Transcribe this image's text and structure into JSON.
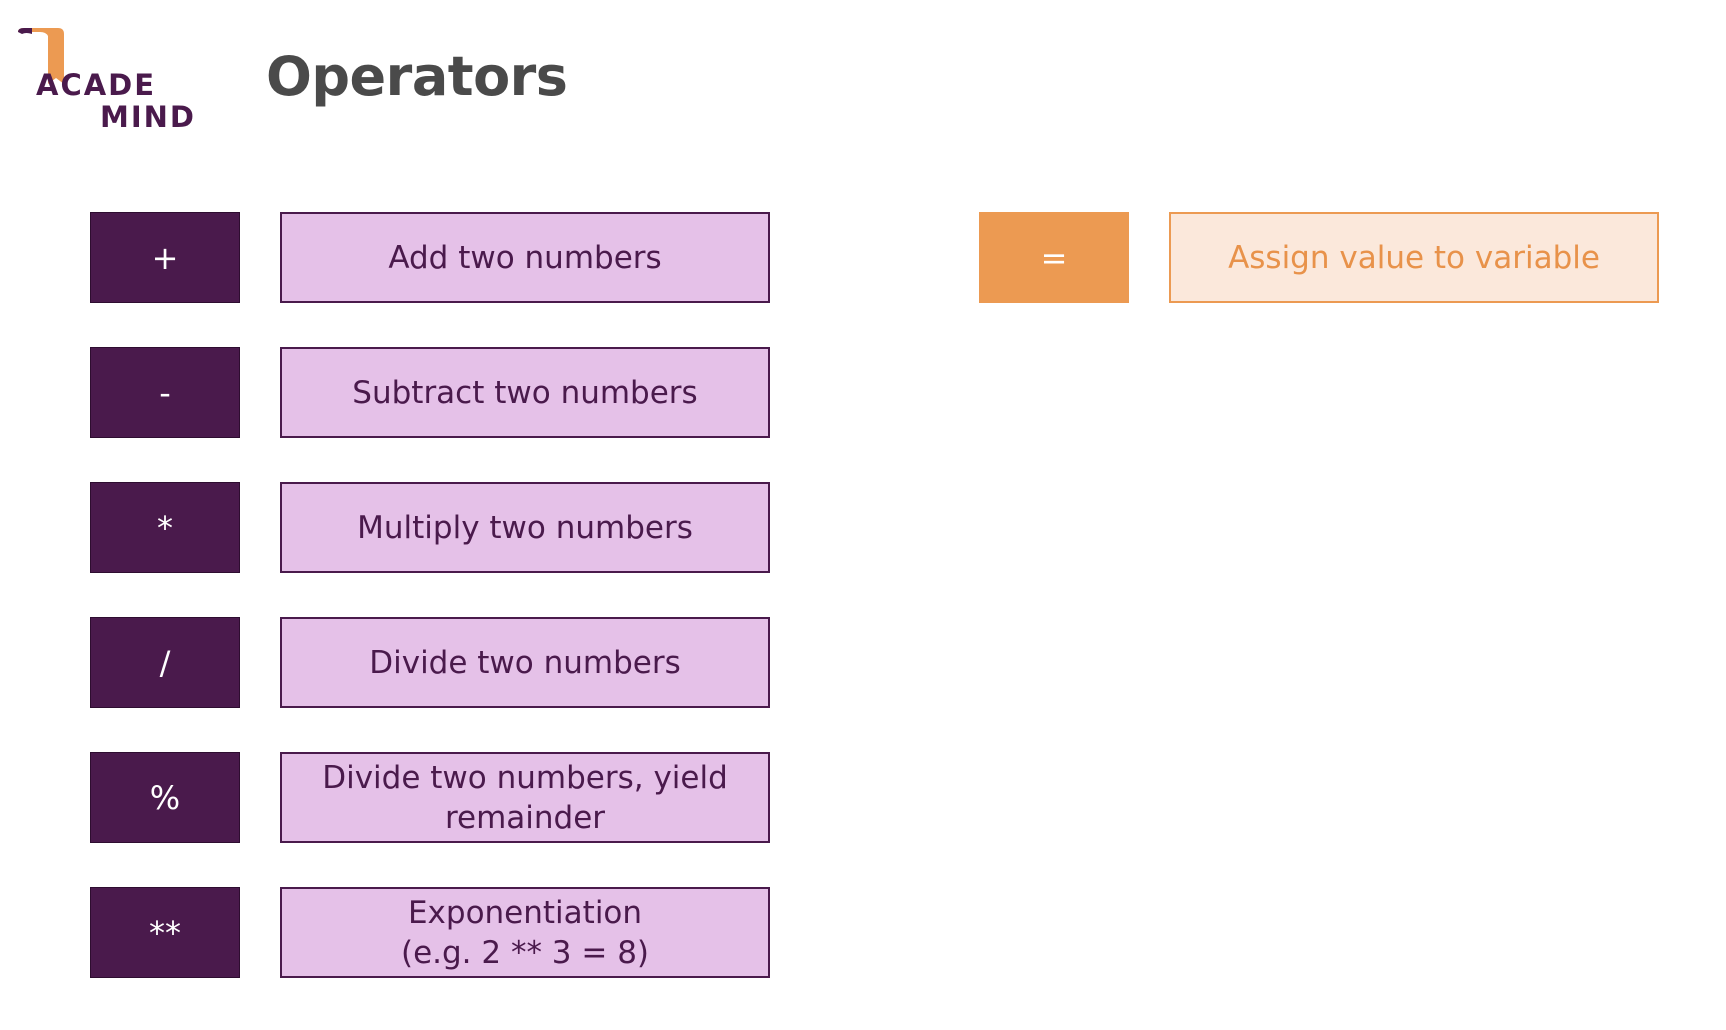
{
  "header": {
    "title": "Operators",
    "logo": {
      "line1": "ACADE",
      "line2": "MIND",
      "primary_color": "#4a1a4c",
      "accent_color": "#ec9a52"
    }
  },
  "arithmetic_operators": [
    {
      "symbol": "+",
      "description": "Add two numbers"
    },
    {
      "symbol": "-",
      "description": "Subtract two numbers"
    },
    {
      "symbol": "*",
      "description": "Multiply two numbers"
    },
    {
      "symbol": "/",
      "description": "Divide two numbers"
    },
    {
      "symbol": "%",
      "description": "Divide two numbers, yield\nremainder"
    },
    {
      "symbol": "**",
      "description": "Exponentiation\n(e.g. 2 ** 3 = 8)"
    }
  ],
  "assignment_operator": {
    "symbol": "=",
    "description": "Assign value to variable"
  },
  "colors": {
    "operator_fill": "#4a1a4c",
    "description_fill": "#e5c1e8",
    "assignment_fill": "#ec9a52",
    "assignment_description_fill": "#fbe8db",
    "title_text": "#4a4a4a"
  }
}
